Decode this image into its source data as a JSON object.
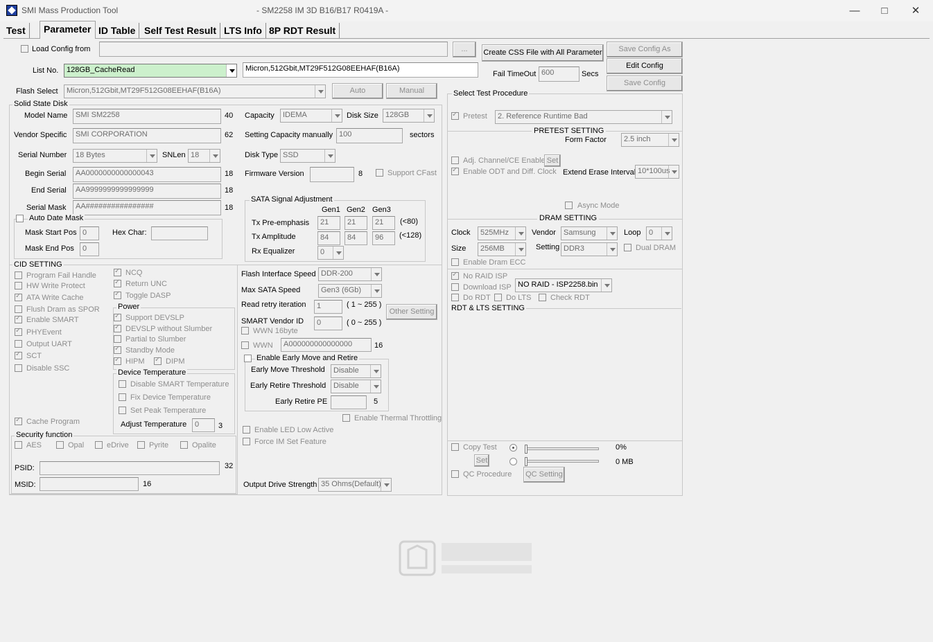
{
  "window": {
    "app_name": "SMI Mass Production Tool",
    "doc_title": "- SM2258 IM 3D B16/B17 R0419A -"
  },
  "tabs": [
    "Test",
    "Parameter",
    "ID Table",
    "Self Test Result",
    "LTS Info",
    "8P RDT Result"
  ],
  "top": {
    "load_config_from": "Load Config from",
    "browse": "...",
    "list_no_label": "List No.",
    "list_no_value": "128GB_CacheRead",
    "flash_desc": "Micron,512Gbit,MT29F512G08EEHAF(B16A)",
    "flash_select_label": "Flash Select",
    "flash_select_value": "Micron,512Gbit,MT29F512G08EEHAF(B16A)",
    "auto": "Auto",
    "manual": "Manual",
    "create_css": "Create CSS File with All Parameter",
    "save_config_as": "Save Config As",
    "edit_config": "Edit Config",
    "save_config": "Save Config",
    "fail_timeout": "Fail TimeOut",
    "fail_timeout_value": "600",
    "secs": "Secs"
  },
  "ssd": {
    "group": "Solid State Disk",
    "model_name": "Model Name",
    "model_value": "SMI SM2258",
    "model_len": "40",
    "vendor_specific": "Vendor Specific",
    "vendor_value": "SMI CORPORATION",
    "vendor_len": "62",
    "serial_number": "Serial Number",
    "serial_value": "18 Bytes",
    "snlen": "SNLen",
    "snlen_value": "18",
    "begin_serial": "Begin Serial",
    "begin_value": "AA0000000000000043",
    "begin_len": "18",
    "end_serial": "End Serial",
    "end_value": "AA9999999999999999",
    "end_len": "18",
    "serial_mask": "Serial Mask",
    "mask_value": "AA################",
    "mask_len": "18",
    "auto_date_mask": "Auto Date Mask",
    "mask_start": "Mask Start Pos",
    "mask_start_value": "0",
    "hex_char": "Hex Char:",
    "mask_end": "Mask End Pos",
    "mask_end_value": "0",
    "capacity": "Capacity",
    "capacity_value": "IDEMA",
    "disk_size": "Disk Size",
    "disk_size_value": "128GB",
    "setting_cap": "Setting Capacity manually",
    "setting_cap_value": "100",
    "sectors": "sectors",
    "disk_type": "Disk Type",
    "disk_type_value": "SSD",
    "fw_version": "Firmware Version",
    "fw_len": "8",
    "support_cfast": "Support CFast"
  },
  "sata": {
    "group": "SATA Signal Adjustment",
    "gen1": "Gen1",
    "gen2": "Gen2",
    "gen3": "Gen3",
    "tx_pre": "Tx Pre-emphasis",
    "pre_values": [
      "21",
      "21",
      "21"
    ],
    "pre_limit": "(<80)",
    "tx_amp": "Tx Amplitude",
    "amp_values": [
      "84",
      "84",
      "96"
    ],
    "amp_limit": "(<128)",
    "rx_eq": "Rx Equalizer",
    "rx_value": "0"
  },
  "cid": {
    "group": "CID SETTING",
    "items": [
      "Program Fail Handle",
      "HW Write Protect",
      "ATA Write Cache",
      "Flush Dram as SPOR",
      "Enable SMART",
      "PHYEvent",
      "Output UART",
      "SCT",
      "Disable SSC"
    ],
    "items2": [
      "NCQ",
      "Return UNC",
      "Toggle DASP"
    ],
    "cache_program": "Cache Program"
  },
  "power": {
    "group": "Power",
    "items": [
      "Support DEVSLP",
      "DEVSLP without Slumber",
      "Partial to Slumber",
      "Standby Mode",
      "HIPM"
    ],
    "dipm": "DIPM"
  },
  "device_temp": {
    "group": "Device Temperature",
    "items": [
      "Disable SMART Temperature",
      "Fix Device Temperature",
      "Set Peak Temperature"
    ],
    "adjust": "Adjust Temperature",
    "adjust_value": "0",
    "adjust_len": "3"
  },
  "security": {
    "group": "Security function",
    "items": [
      "AES",
      "Opal",
      "eDrive",
      "Pyrite",
      "Opalite"
    ],
    "psid": "PSID:",
    "psid_len": "32",
    "msid": "MSID:",
    "msid_len": "16"
  },
  "mid": {
    "flash_if_speed": "Flash Interface Speed",
    "flash_if_value": "DDR-200",
    "max_sata": "Max SATA Speed",
    "max_sata_value": "Gen3 (6Gb)",
    "read_retry": "Read retry iteration",
    "read_retry_value": "1",
    "read_retry_range": "( 1 ~ 255 )",
    "smart_vendor": "SMART Vendor ID",
    "smart_vendor_value": "0",
    "smart_range": "( 0 ~ 255 )",
    "other_setting": "Other Setting",
    "wwn16": "WWN 16byte",
    "wwn": "WWN",
    "wwn_value": "A000000000000000",
    "wwn_len": "16",
    "early_group": "Enable Early Move and Retire",
    "early_move": "Early Move Threshold",
    "early_move_value": "Disable",
    "early_retire": "Early Retire Threshold",
    "early_retire_value": "Disable",
    "early_retire_pe": "Early Retire PE",
    "early_pe_len": "5",
    "thermal": "Enable Thermal Throttling",
    "led": "Enable LED Low Active",
    "force_im": "Force IM Set Feature",
    "output_drive": "Output Drive Strength",
    "output_drive_value": "35 Ohms(Default)"
  },
  "right": {
    "group": "Select Test Procedure",
    "pretest": "Pretest",
    "procedure_value": "2. Reference Runtime Bad",
    "pretest_setting": "PRETEST SETTING",
    "form_factor": "Form Factor",
    "form_factor_value": "2.5 inch",
    "adj_channel": "Adj. Channel/CE Enable",
    "set": "Set",
    "enable_odt": "Enable ODT and Diff. Clock",
    "extend_erase": "Extend Erase Interval",
    "extend_value": "10*100us",
    "async": "Async Mode",
    "dram_setting": "DRAM SETTING",
    "clock": "Clock",
    "clock_value": "525MHz",
    "vendor": "Vendor",
    "vendor_value": "Samsung",
    "loop": "Loop",
    "loop_value": "0",
    "size": "Size",
    "size_value": "256MB",
    "setting": "Setting",
    "setting_value": "DDR3",
    "dual_dram": "Dual DRAM",
    "enable_ecc": "Enable Dram ECC",
    "no_raid_isp": "No RAID ISP",
    "download_isp": "Download ISP",
    "isp_value": "NO RAID - ISP2258.bin",
    "do_rdt": "Do RDT",
    "do_lts": "Do LTS",
    "check_rdt": "Check RDT",
    "rdt_lts": "RDT & LTS SETTING",
    "copy_test": "Copy Test",
    "pct": "0%",
    "mb": "0 MB",
    "set2": "Set",
    "qc_procedure": "QC Procedure",
    "qc_setting": "QC Setting"
  }
}
